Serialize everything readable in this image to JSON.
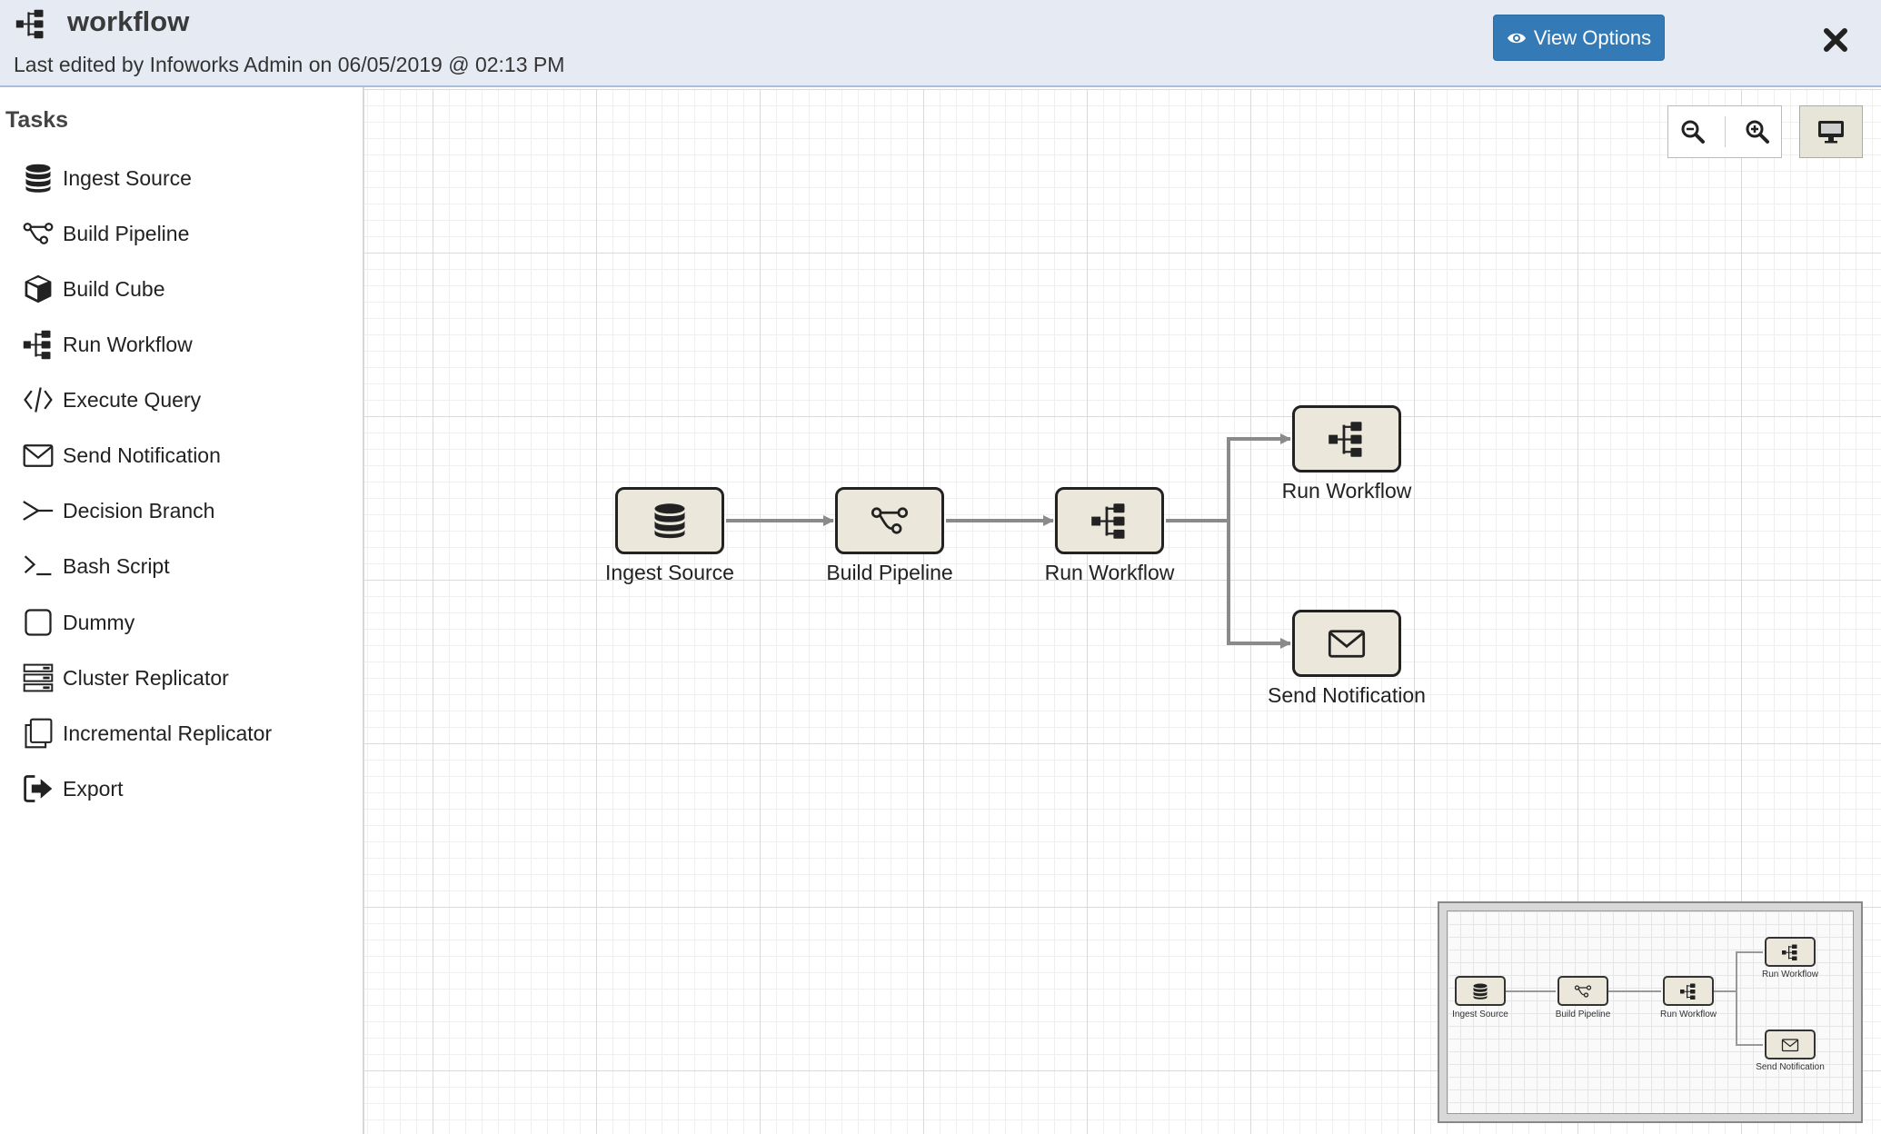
{
  "header": {
    "title": "workflow",
    "subtitle": "Last edited by Infoworks Admin on 06/05/2019 @ 02:13 PM",
    "view_options_label": "View Options",
    "accent_color": "#337ab7",
    "icons": {
      "app": "sitemap-icon",
      "view_options": "eye-icon",
      "close": "close-icon"
    }
  },
  "sidebar": {
    "heading": "Tasks",
    "items": [
      {
        "label": "Ingest Source",
        "icon": "database-icon"
      },
      {
        "label": "Build Pipeline",
        "icon": "pipeline-icon"
      },
      {
        "label": "Build Cube",
        "icon": "cube-icon"
      },
      {
        "label": "Run Workflow",
        "icon": "sitemap-icon"
      },
      {
        "label": "Execute Query",
        "icon": "code-icon"
      },
      {
        "label": "Send Notification",
        "icon": "envelope-icon"
      },
      {
        "label": "Decision Branch",
        "icon": "branch-icon"
      },
      {
        "label": "Bash Script",
        "icon": "terminal-icon"
      },
      {
        "label": "Dummy",
        "icon": "square-icon"
      },
      {
        "label": "Cluster Replicator",
        "icon": "server-icon"
      },
      {
        "label": "Incremental Replicator",
        "icon": "copy-icon"
      },
      {
        "label": "Export",
        "icon": "sign-out-icon"
      }
    ]
  },
  "toolbar": {
    "icons": {
      "zoom_out": "zoom-out-icon",
      "zoom_in": "zoom-in-icon",
      "display": "desktop-icon"
    }
  },
  "workflow": {
    "nodes": [
      {
        "id": "n1",
        "label": "Ingest Source",
        "icon": "database-icon"
      },
      {
        "id": "n2",
        "label": "Build Pipeline",
        "icon": "pipeline-icon"
      },
      {
        "id": "n3",
        "label": "Run Workflow",
        "icon": "sitemap-icon"
      },
      {
        "id": "n4",
        "label": "Run Workflow",
        "icon": "sitemap-icon"
      },
      {
        "id": "n5",
        "label": "Send Notification",
        "icon": "envelope-icon"
      }
    ],
    "edges": [
      {
        "from": "n1",
        "to": "n2"
      },
      {
        "from": "n2",
        "to": "n3"
      },
      {
        "from": "n3",
        "to": "n4"
      },
      {
        "from": "n3",
        "to": "n5"
      }
    ]
  },
  "minimap": {
    "labels": [
      "Ingest Source",
      "Build Pipeline",
      "Run Workflow",
      "Run Workflow",
      "Send Notification"
    ]
  }
}
